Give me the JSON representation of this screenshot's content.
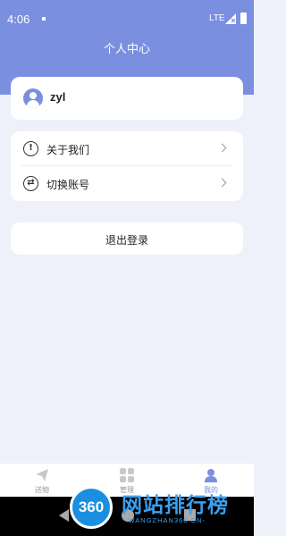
{
  "status_bar": {
    "time": "4:06",
    "network": "LTE"
  },
  "header": {
    "title": "个人中心",
    "background_color": "#7b8fe0"
  },
  "profile": {
    "username": "zyl",
    "avatar_icon": "user-avatar-icon"
  },
  "menu": {
    "items": [
      {
        "label": "关于我们",
        "icon": "info-circle-icon",
        "glyph": "!"
      },
      {
        "label": "切换账号",
        "icon": "switch-account-icon",
        "glyph": "⇄"
      }
    ]
  },
  "logout": {
    "label": "退出登录"
  },
  "tabbar": {
    "accent_color": "#7b8fe0",
    "tabs": [
      {
        "label": "送物",
        "icon": "paper-plane-icon",
        "active": false
      },
      {
        "label": "管理",
        "icon": "grid-icon",
        "active": false
      },
      {
        "label": "我的",
        "icon": "person-icon",
        "active": true
      }
    ]
  },
  "watermark": {
    "logo_text": "360",
    "title": "网站排行榜",
    "subtitle": "-WANGZHAN360.CN-"
  }
}
